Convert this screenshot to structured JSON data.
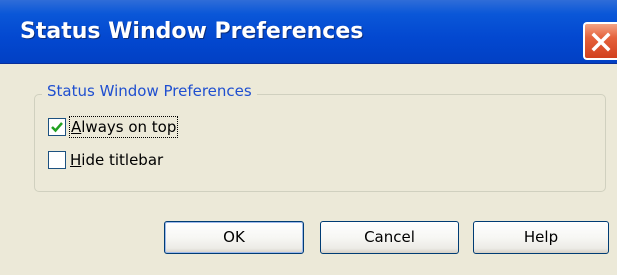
{
  "window": {
    "title": "Status Window Preferences"
  },
  "group": {
    "label": "Status Window Preferences"
  },
  "options": {
    "always_on_top": {
      "label_prefix": "",
      "mnemonic": "A",
      "label_rest": "lways on top",
      "checked": true
    },
    "hide_titlebar": {
      "label_prefix": "",
      "mnemonic": "H",
      "label_rest": "ide titlebar",
      "checked": false
    }
  },
  "buttons": {
    "ok": "OK",
    "cancel": "Cancel",
    "help": "Help"
  },
  "colors": {
    "titlebar": "#0348d0",
    "close_button": "#d2401e",
    "dialog_background": "#ece9d8",
    "group_label": "#1f4fd0",
    "checkmark": "#21a121"
  },
  "icons": {
    "close": "close-x-icon",
    "check": "checkmark-icon"
  }
}
